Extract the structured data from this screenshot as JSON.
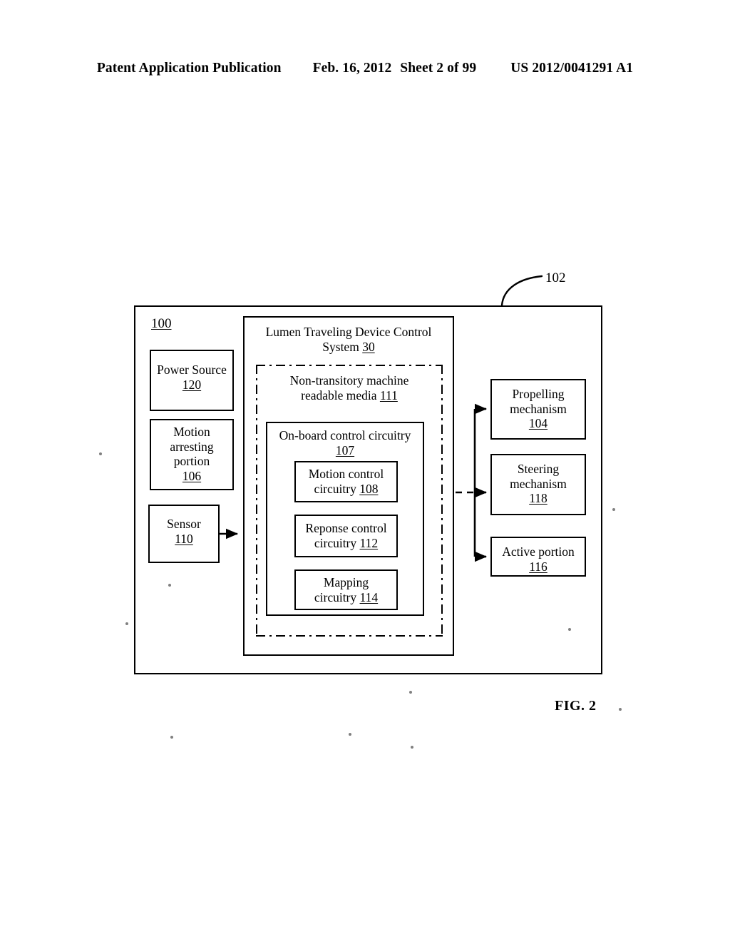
{
  "header": {
    "publication": "Patent Application Publication",
    "date": "Feb. 16, 2012",
    "sheet": "Sheet 2 of 99",
    "patent_number": "US 2012/0041291 A1"
  },
  "figure": {
    "label": "FIG. 2",
    "outer_ref": "102",
    "device_ref": "100"
  },
  "diagram": {
    "type": "block-diagram",
    "control_system": {
      "title_line1": "Lumen Traveling Device Control",
      "title_line2": "System",
      "ref": "30"
    },
    "media": {
      "title_line1": "Non-transitory machine",
      "title_line2": "readable media",
      "ref": "111"
    },
    "onboard": {
      "title_line1": "On-board control circuitry",
      "ref": "107"
    },
    "left_blocks": [
      {
        "name": "power-source",
        "line1": "Power Source",
        "line2": "",
        "ref": "120"
      },
      {
        "name": "motion-arresting-portion",
        "line1": "Motion",
        "line2": "arresting",
        "line3": "portion",
        "ref": "106"
      },
      {
        "name": "sensor",
        "line1": "Sensor",
        "line2": "",
        "ref": "110"
      }
    ],
    "inner_blocks": [
      {
        "name": "motion-control-circuitry",
        "line1": "Motion control",
        "line2": "circuitry",
        "ref": "108"
      },
      {
        "name": "response-control-circuitry",
        "line1": "Reponse control",
        "line2": "circuitry",
        "ref": "112"
      },
      {
        "name": "mapping-circuitry",
        "line1": "Mapping",
        "line2": "circuitry",
        "ref": "114"
      }
    ],
    "right_blocks": [
      {
        "name": "propelling-mechanism",
        "line1": "Propelling",
        "line2": "mechanism",
        "ref": "104"
      },
      {
        "name": "steering-mechanism",
        "line1": "Steering",
        "line2": "mechanism",
        "ref": "118"
      },
      {
        "name": "active-portion",
        "line1": "Active portion",
        "line2": "",
        "ref": "116"
      }
    ]
  },
  "colors": {
    "ink": "#000000",
    "paper": "#ffffff"
  }
}
